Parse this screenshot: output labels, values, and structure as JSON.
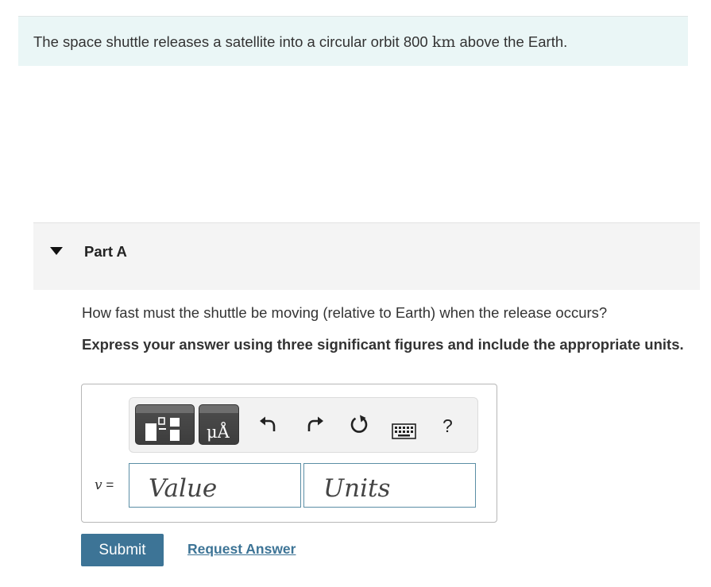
{
  "intro": {
    "text_before": "The space shuttle releases a satellite into a circular orbit 800 ",
    "unit": "km",
    "text_after": " above the Earth."
  },
  "part": {
    "title": "Part A"
  },
  "question": {
    "prompt": "How fast must the shuttle be moving (relative to Earth) when the release occurs?",
    "instruction": "Express your answer using three significant figures and include the appropriate units."
  },
  "toolbar": {
    "units_button_label": "μÅ",
    "help_label": "?",
    "icons": [
      "templates-icon",
      "units-icon",
      "undo-icon",
      "redo-icon",
      "reset-icon",
      "keyboard-icon",
      "help-icon"
    ]
  },
  "answer": {
    "variable": "v",
    "equals": "=",
    "value_placeholder": "Value",
    "units_placeholder": "Units"
  },
  "actions": {
    "submit_label": "Submit",
    "request_label": "Request Answer"
  },
  "colors": {
    "intro_bg": "#eaf6f6",
    "accent": "#3d7496",
    "part_header_bg": "#f4f4f4"
  }
}
